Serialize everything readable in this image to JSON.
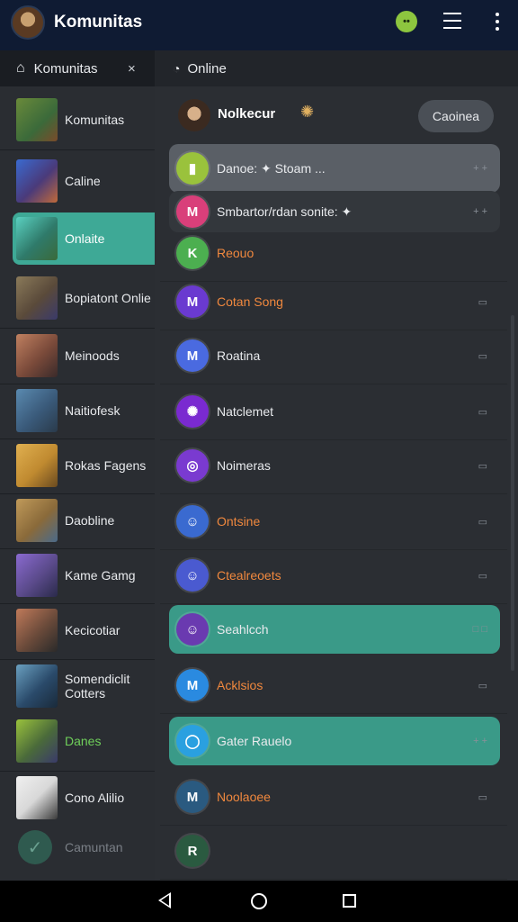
{
  "topbar": {
    "title": "Komunitas",
    "status_badge": "••"
  },
  "tabs": {
    "left_label": "Komunitas",
    "left_close": "×",
    "right_label": "Online"
  },
  "sidebar": {
    "items": [
      {
        "label": "Komunitas",
        "color": "#3b6a3a"
      },
      {
        "label": "Caline",
        "color": "#4a3a7a"
      },
      {
        "label": "Onlaite",
        "color": "#2f7a6a",
        "active": true
      },
      {
        "label": "Bopiatont Onlie",
        "color": "#5a4a3a"
      },
      {
        "label": "Meinoods",
        "color": "#7a4a3a"
      },
      {
        "label": "Naitiofesk",
        "color": "#3a5a7a"
      },
      {
        "label": "Rokas Fagens",
        "color": "#c08a30"
      },
      {
        "label": "Daobline",
        "color": "#8a6a3a"
      },
      {
        "label": "Kame Gamg",
        "color": "#5a4a8a"
      },
      {
        "label": "Kecicotiar",
        "color": "#6a4a3a"
      },
      {
        "label": "Somendiclit Cotters",
        "color": "#2a4a6a"
      },
      {
        "label": "Danes",
        "color": "#4a6a3a",
        "green": true
      },
      {
        "label": "Cono Alilio",
        "color": "#d8d8d8"
      },
      {
        "label": "Camuntan",
        "dim": true
      }
    ]
  },
  "main": {
    "header": {
      "name": "Nolkecur",
      "button": "Caoinea"
    },
    "rows": [
      {
        "text": "Danoe: ✦ Stoam ...",
        "end": "+ +",
        "icon_color": "#9ac23c",
        "icon": "▮",
        "style": "grey",
        "text_color": "white"
      },
      {
        "text": "Smbartor/rdan sonite: ✦",
        "end": "+ +",
        "icon_color": "#d93f7a",
        "icon": "M",
        "style": "dark",
        "text_color": "white"
      },
      {
        "text": "Reouo",
        "end": "",
        "icon_color": "#4caf50",
        "icon": "K",
        "style": "none",
        "text_color": "orange"
      },
      {
        "text": "Cotan Song",
        "end": "▭",
        "icon_color": "#6a3ad0",
        "icon": "M",
        "style": "none",
        "text_color": "orange"
      },
      {
        "text": "Roatina",
        "end": "▭",
        "icon_color": "#4a6ae0",
        "icon": "M",
        "style": "none",
        "text_color": "white"
      },
      {
        "text": "Natclemet",
        "end": "▭",
        "icon_color": "#7a2ad0",
        "icon": "✺",
        "style": "none",
        "text_color": "white"
      },
      {
        "text": "Noimeras",
        "end": "▭",
        "icon_color": "#7a3ad0",
        "icon": "◎",
        "style": "none",
        "text_color": "white"
      },
      {
        "text": "Ontsine",
        "end": "▭",
        "icon_color": "#3a6ad0",
        "icon": "☺",
        "style": "none",
        "text_color": "orange"
      },
      {
        "text": "Ctealreoets",
        "end": "▭",
        "icon_color": "#4a5ad0",
        "icon": "☺",
        "style": "none",
        "text_color": "orange"
      },
      {
        "text": "Seahlcch",
        "end": "□ □",
        "icon_color": "#6a3ab0",
        "icon": "☺",
        "style": "teal",
        "text_color": "white"
      },
      {
        "text": "Acklsios",
        "end": "▭",
        "icon_color": "#2a8ae0",
        "icon": "M",
        "style": "none",
        "text_color": "orange"
      },
      {
        "text": "Gater Rauelo",
        "end": "+ +",
        "icon_color": "#2aa0e0",
        "icon": "◯",
        "style": "teal",
        "text_color": "white"
      },
      {
        "text": "Noolaoee",
        "end": "▭",
        "icon_color": "#2a5a80",
        "icon": "M",
        "style": "none",
        "text_color": "orange"
      },
      {
        "text": "",
        "end": "",
        "icon_color": "#2a5a40",
        "icon": "R",
        "style": "none",
        "text_color": "white"
      }
    ]
  }
}
